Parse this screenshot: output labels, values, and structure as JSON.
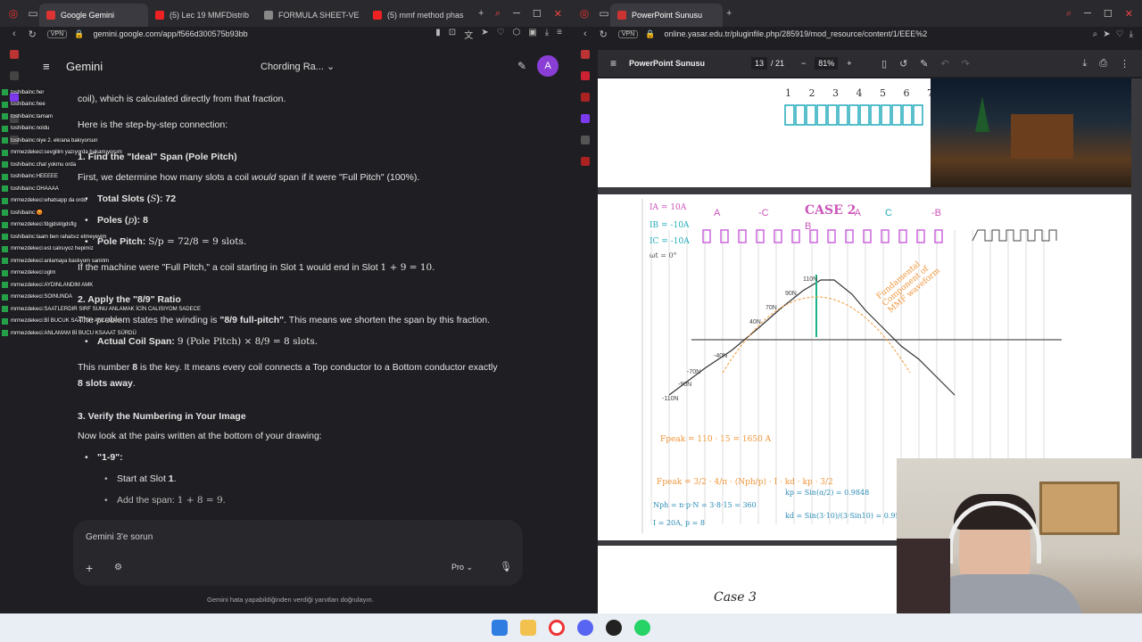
{
  "left_window": {
    "tabs": [
      {
        "label": "Google Gemini",
        "active": true
      },
      {
        "label": "(5) Lec 19 MMFDistrib",
        "active": false
      },
      {
        "label": "FORMULA SHEET-VE",
        "active": false
      },
      {
        "label": "(5) mmf method phas",
        "active": false
      }
    ],
    "vpn": "VPN",
    "url": "gemini.google.com/app/f566d300575b93bb"
  },
  "gemini": {
    "title": "Gemini",
    "chat_title": "Chording Ra...",
    "avatar": "A",
    "lines": {
      "l1": "coil), which is calculated directly from that fraction.",
      "l2": "Here is the step-by-step connection:",
      "h1": "1. Find the \"Ideal\" Span (Pole Pitch)",
      "l3a": "First, we determine how many slots a coil ",
      "l3b": "would",
      "l3c": " span if it were \"Full Pitch\" (100%).",
      "b1a": "Total Slots (",
      "b1m": "S",
      "b1b": "): 72",
      "b2a": "Poles (",
      "b2m": "p",
      "b2b": "): 8",
      "b3a": "Pole Pitch: ",
      "b3m": "S/p = 72/8 = 9",
      "b3b": " slots.",
      "l4a": "If the machine were \"Full Pitch,\" a coil starting in Slot 1 would end in Slot ",
      "l4m": "1 + 9 = 10",
      "l4b": ".",
      "h2": "2. Apply the \"8/9\" Ratio",
      "l5a": "The problem states the winding is ",
      "l5b": "\"8/9 full-pitch\"",
      "l5c": ". This means we shorten the span by this fraction.",
      "b4a": "Actual Coil Span: ",
      "b4m": "9 (Pole Pitch) × 8/9 = 8",
      "b4b": " slots.",
      "l6a": "This number ",
      "l6b": "8",
      "l6c": " is the key. It means every coil connects a Top conductor to a Bottom conductor exactly",
      "l7": "8 slots away",
      "l7b": ".",
      "h3": "3. Verify the Numbering in Your Image",
      "l8": "Now look at the pairs written at the bottom of your drawing:",
      "b5": "\"1-9\":",
      "c1a": "Start at Slot ",
      "c1b": "1",
      "c1c": ".",
      "c2a": "Add the span: ",
      "c2m": "1 + 8 = 9",
      "c2b": "."
    },
    "input_placeholder": "Gemini 3'e sorun",
    "mode_label": "Pro",
    "disclaimer": "Gemini hata yapabildiğinden verdiği yanıtları doğrulayın."
  },
  "chat_overlay": [
    {
      "user": "toshibainc",
      "msg": "her"
    },
    {
      "user": "toshibainc",
      "msg": "hee"
    },
    {
      "user": "toshibainc",
      "msg": "tamam"
    },
    {
      "user": "toshibainc",
      "msg": "noldu"
    },
    {
      "user": "toshibainc",
      "msg": "niye 2. ekrana bakıyorsun"
    },
    {
      "user": "mrmezdekeci",
      "msg": "sevgilim yazıyorda bakamıyorum"
    },
    {
      "user": "toshibainc",
      "msg": "chat yokmu orda"
    },
    {
      "user": "toshibainc",
      "msg": "HEEEEE"
    },
    {
      "user": "toshibainc",
      "msg": "OHAAAA"
    },
    {
      "user": "mrmezdekeci",
      "msg": "whatsapp da ordu"
    },
    {
      "user": "toshibainc",
      "msg": "😡"
    },
    {
      "user": "mrmezdekeci",
      "msg": "fdgjdsklgdsflg"
    },
    {
      "user": "toshibainc",
      "msg": "taam ben rahatsız etmeyeyim"
    },
    {
      "user": "mrmezdekeci",
      "msg": "est calısıyoz hepimiz"
    },
    {
      "user": "mrmezdekeci",
      "msg": "anlamaya baslıyom sanirim"
    },
    {
      "user": "mrmezdekeci",
      "msg": "oglm"
    },
    {
      "user": "mrmezdekeci",
      "msg": "AYDINLANDIM AMK"
    },
    {
      "user": "mrmezdekeci",
      "msg": "SOINUNDA"
    },
    {
      "user": "mrmezdekeci",
      "msg": "SAATLERDIR SIRF SUNU ANLAMAK İCİN CALISIYOM SADECE"
    },
    {
      "user": "mrmezdekeci",
      "msg": "Bİ BUCUK SAATTİR ANLAMAYA"
    },
    {
      "user": "mrmezdekeci",
      "msg": "ANLAMAM Bİ BUCU KSAAAT SÜRDÜ"
    }
  ],
  "right_window": {
    "tabs": [
      {
        "label": "PowerPoint Sunusu",
        "active": true
      }
    ],
    "vpn": "VPN",
    "url": "online.yasar.edu.tr/pluginfile.php/285919/mod_resource/content/1/EEE%2",
    "pdf": {
      "title": "PowerPoint Sunusu",
      "page_current": "13",
      "page_total": "/ 21",
      "zoom": "81%",
      "case_title": "CASE 2",
      "case_next": "Case 3",
      "slot_numbers": "1 2 3 4 5 6 7",
      "phase_labels": [
        "A",
        "-C",
        "B",
        "-A",
        "C",
        "-B"
      ],
      "currents": [
        "IA = 10A",
        "IB = -10A",
        "IC = -10A",
        "ωt = 0°"
      ],
      "annotation": "Fundamental Component of MMF waveform",
      "formulas": [
        "Fpeak = 110 · 15 = 1650 A",
        "Fpeak = 3/2 · 4/π · (Nph/p) · I · kd · kp · 3/2",
        "Nph = n·p·N = 3·8·15 = 360",
        "kp = Sin(α/2) = 0.9848",
        "kd = Sin(3·10)/(3·Sin10) = 0.9597",
        "I = 20A, p = 8"
      ],
      "mmf_levels": [
        "110N",
        "90N",
        "70N",
        "40N",
        "-40N",
        "-70N",
        "-90N",
        "-110N"
      ]
    }
  },
  "colors": {
    "accent_gemini": "#8a3ed6",
    "chat_badge": "#24a148",
    "pdf_toolbar": "#2d2d31"
  }
}
